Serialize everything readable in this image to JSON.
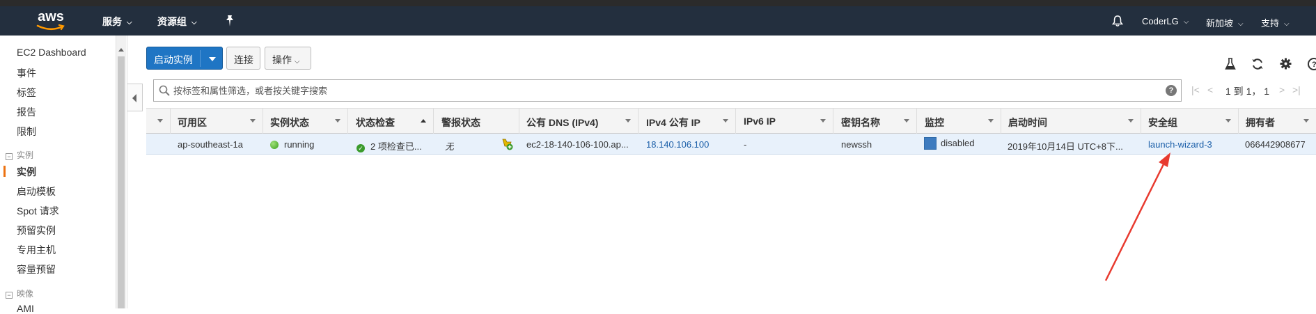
{
  "nav": {
    "logo": "aws",
    "services": "服务",
    "resource_groups": "资源组",
    "user": "CoderLG",
    "region": "新加坡",
    "support": "支持"
  },
  "sidebar": {
    "items_top": [
      "EC2 Dashboard",
      "事件",
      "标签",
      "报告",
      "限制"
    ],
    "section_instances": "实例",
    "items_instances": [
      "实例",
      "启动模板",
      "Spot 请求",
      "预留实例",
      "专用主机",
      "容量预留"
    ],
    "section_images": "映像",
    "items_images": [
      "AMI"
    ]
  },
  "toolbar": {
    "launch": "启动实例",
    "connect": "连接",
    "actions": "操作"
  },
  "filter": {
    "placeholder": "按标签和属性筛选，或者按关键字搜索"
  },
  "pager": {
    "text": "1 到 1， 1"
  },
  "table": {
    "headers": [
      "可用区",
      "实例状态",
      "状态检查",
      "警报状态",
      "公有 DNS (IPv4)",
      "IPv4 公有 IP",
      "IPv6 IP",
      "密钥名称",
      "监控",
      "启动时间",
      "安全组",
      "拥有者"
    ],
    "row": {
      "az": "ap-southeast-1a",
      "state": "running",
      "status_check": "2 项检查已...",
      "alarm": "无",
      "public_dns": "ec2-18-140-106-100.ap...",
      "ipv4": "18.140.106.100",
      "ipv6": "-",
      "key_name": "newssh",
      "monitoring": "disabled",
      "launch_time": "2019年10月14日 UTC+8下...",
      "security_group": "launch-wizard-3",
      "owner": "066442908677"
    }
  },
  "colors": {
    "navbar": "#232f3e",
    "primary_button": "#1f75c4",
    "link": "#1a5ea8",
    "annotation_arrow": "#e83a2f",
    "selected_row": "#e8f1fb"
  }
}
